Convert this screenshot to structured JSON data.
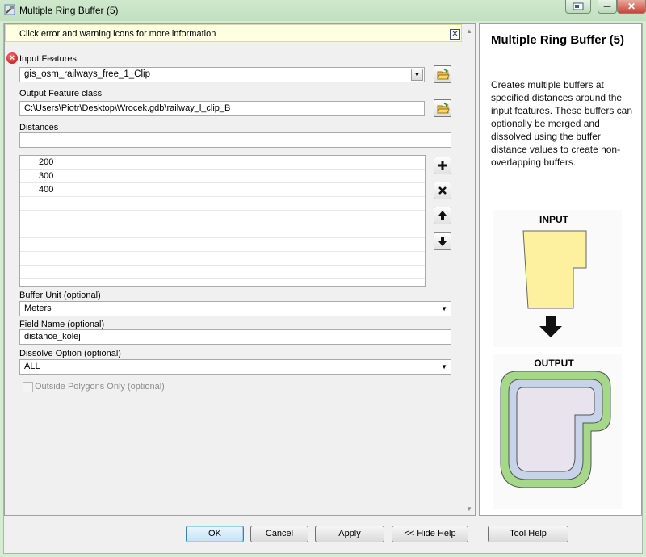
{
  "window": {
    "title": "Multiple Ring Buffer (5)",
    "controls": [
      "?",
      "─",
      "✕"
    ]
  },
  "info_bar": {
    "text": "Click error and warning icons for more information",
    "close_glyph": "✕"
  },
  "form": {
    "input_features": {
      "label": "Input Features",
      "value": "gis_osm_railways_free_1_Clip",
      "status": "error"
    },
    "output_class": {
      "label": "Output Feature class",
      "value": "C:\\Users\\Piotr\\Desktop\\Wrocek.gdb\\railway_l_clip_B"
    },
    "distances": {
      "label": "Distances",
      "value": "",
      "items": [
        "200",
        "300",
        "400"
      ]
    },
    "buffer_unit": {
      "label": "Buffer Unit (optional)",
      "value": "Meters"
    },
    "field_name": {
      "label": "Field Name (optional)",
      "value": "distance_kolej"
    },
    "dissolve": {
      "label": "Dissolve Option (optional)",
      "value": "ALL"
    },
    "outside_only": {
      "label": "Outside Polygons Only (optional)",
      "checked": false,
      "enabled": false
    }
  },
  "list_tools": [
    "add-icon",
    "remove-icon",
    "move-up-icon",
    "move-down-icon"
  ],
  "help": {
    "title": "Multiple Ring Buffer (5)",
    "description": "Creates multiple buffers at specified distances around the input features. These buffers can optionally be merged and dissolved using the buffer distance values to create non-overlapping buffers.",
    "input_label": "INPUT",
    "output_label": "OUTPUT"
  },
  "buttons": {
    "ok": "OK",
    "cancel": "Cancel",
    "apply": "Apply",
    "hide_help": "<< Hide Help",
    "tool_help": "Tool Help"
  },
  "colors": {
    "info_bg": "#ffffe1",
    "input_poly": "#fdf1a0",
    "ring_outer": "#a6d88a",
    "ring_mid": "#c6d3e8",
    "ring_inner": "#e9e3ee"
  }
}
